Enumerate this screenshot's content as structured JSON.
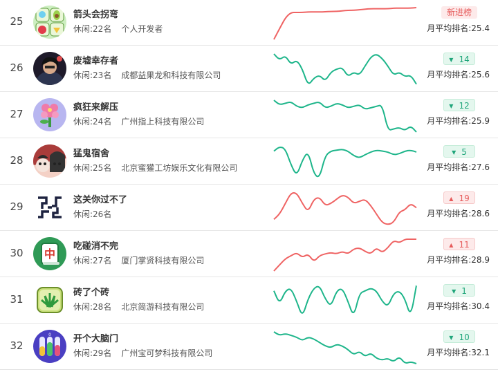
{
  "colors": {
    "up": "#ef6363",
    "down": "#1db58a"
  },
  "rows": [
    {
      "rank": "25",
      "name": "箭头会拐弯",
      "category_rank": "休闲:22名",
      "developer": "个人开发者",
      "badge_type": "new",
      "badge": "新进榜",
      "avg_rank": "月平均排名:25.4",
      "icon": "fruit-puzzle-icon",
      "trend": "up",
      "series": [
        60,
        40,
        20,
        10,
        10,
        10,
        9,
        9,
        9,
        9,
        8,
        8,
        7,
        6,
        6,
        5,
        4,
        3,
        3,
        3,
        3,
        2,
        2,
        2,
        2,
        1
      ]
    },
    {
      "rank": "26",
      "name": "废墟幸存者",
      "category_rank": "休闲:23名",
      "developer": "成都益果龙和科技有限公司",
      "badge_type": "down",
      "badge": "14",
      "avg_rank": "月平均排名:25.6",
      "icon": "survivor-character-icon",
      "trend": "down",
      "series": [
        20,
        28,
        22,
        34,
        28,
        40,
        62,
        52,
        48,
        56,
        44,
        40,
        38,
        50,
        44,
        48,
        36,
        24,
        20,
        26,
        36,
        48,
        44,
        50,
        48,
        60
      ]
    },
    {
      "rank": "27",
      "name": "疯狂来解压",
      "category_rank": "休闲:24名",
      "developer": "广州指上科技有限公司",
      "badge_type": "down",
      "badge": "12",
      "avg_rank": "月平均排名:25.9",
      "icon": "flower-pink-icon",
      "trend": "down",
      "series": [
        20,
        26,
        24,
        22,
        28,
        30,
        26,
        24,
        22,
        30,
        28,
        24,
        26,
        30,
        28,
        26,
        32,
        30,
        28,
        26,
        60,
        58,
        56,
        60,
        54,
        62
      ]
    },
    {
      "rank": "28",
      "name": "猛鬼宿舍",
      "category_rank": "休闲:25名",
      "developer": "北京蜜獾工坊娱乐文化有限公司",
      "badge_type": "down",
      "badge": "5",
      "avg_rank": "月平均排名:27.6",
      "icon": "ghost-dorm-icon",
      "trend": "down",
      "series": [
        40,
        30,
        35,
        70,
        95,
        60,
        40,
        90,
        100,
        50,
        40,
        38,
        36,
        40,
        50,
        55,
        48,
        42,
        38,
        40,
        42,
        48,
        46,
        40,
        38,
        42
      ]
    },
    {
      "rank": "29",
      "name": "这关你过不了",
      "category_rank": "休闲:26名",
      "developer": "",
      "badge_type": "up",
      "badge": "19",
      "avg_rank": "月平均排名:28.6",
      "icon": "maze-swirl-icon",
      "trend": "up",
      "series": [
        55,
        50,
        40,
        30,
        30,
        40,
        48,
        36,
        34,
        42,
        40,
        36,
        32,
        34,
        40,
        38,
        36,
        42,
        50,
        58,
        60,
        58,
        48,
        46,
        40,
        44
      ]
    },
    {
      "rank": "30",
      "name": "吃碰消不完",
      "category_rank": "休闲:27名",
      "developer": "厦门掌贤科技有限公司",
      "badge_type": "up",
      "badge": "11",
      "avg_rank": "月平均排名:28.9",
      "icon": "mahjong-tile-icon",
      "trend": "up",
      "series": [
        80,
        70,
        60,
        55,
        50,
        58,
        52,
        65,
        55,
        52,
        50,
        52,
        48,
        52,
        44,
        42,
        48,
        52,
        42,
        50,
        42,
        30,
        34,
        28,
        28,
        28
      ]
    },
    {
      "rank": "31",
      "name": "砖了个砖",
      "category_rank": "休闲:28名",
      "developer": "北京简游科技有限公司",
      "badge_type": "down",
      "badge": "1",
      "avg_rank": "月平均排名:30.4",
      "icon": "grass-tile-icon",
      "trend": "down",
      "series": [
        40,
        50,
        40,
        38,
        48,
        60,
        46,
        38,
        36,
        46,
        52,
        40,
        38,
        48,
        60,
        42,
        40,
        38,
        40,
        48,
        52,
        42,
        40,
        46,
        60,
        36
      ]
    },
    {
      "rank": "32",
      "name": "开个大脑门",
      "category_rank": "休闲:29名",
      "developer": "广州宝可梦科技有限公司",
      "badge_type": "down",
      "badge": "10",
      "avg_rank": "月平均排名:32.1",
      "icon": "color-tubes-icon",
      "trend": "down",
      "series": [
        24,
        28,
        26,
        28,
        30,
        34,
        30,
        32,
        36,
        40,
        42,
        38,
        40,
        44,
        50,
        46,
        52,
        48,
        54,
        56,
        54,
        58,
        52,
        60,
        58,
        60
      ]
    }
  ]
}
